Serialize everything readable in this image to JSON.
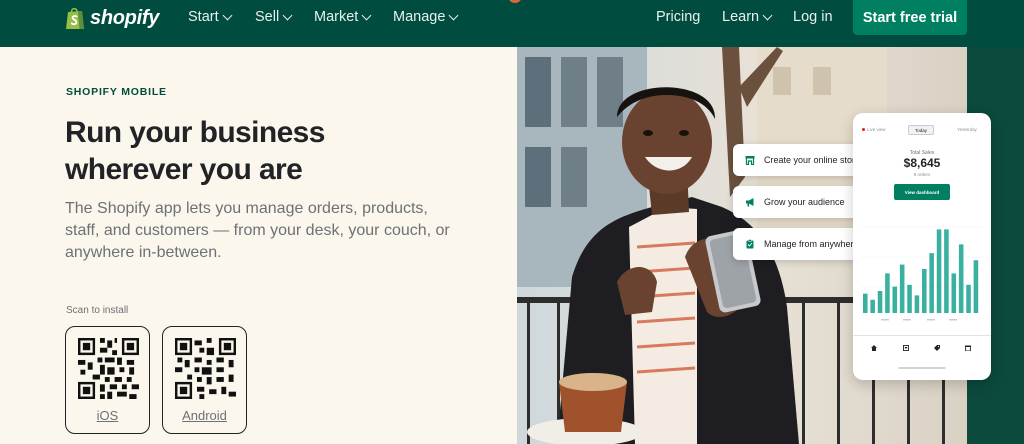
{
  "colors": {
    "nav_bg": "#004c3f",
    "brand_green": "#008060",
    "page_bg": "#fbf7ed",
    "text_dark": "#212326",
    "text_muted": "#6d7175",
    "chart_bar": "#3ab0a0"
  },
  "nav": {
    "logo_text": "shopify",
    "logo_icon": "shopping-bag-icon",
    "menus": [
      {
        "label": "Start"
      },
      {
        "label": "Sell"
      },
      {
        "label": "Market"
      },
      {
        "label": "Manage"
      }
    ],
    "pricing_label": "Pricing",
    "learn_label": "Learn",
    "login_label": "Log in",
    "cta_label": "Start free trial"
  },
  "hero": {
    "eyebrow": "SHOPIFY MOBILE",
    "headline": "Run your business wherever you are",
    "lede": "The Shopify app lets you manage orders, products, staff, and customers — from your desk, your couch, or anywhere in-between.",
    "scan_label": "Scan to install",
    "qr_codes": [
      {
        "label": "iOS"
      },
      {
        "label": "Android"
      }
    ]
  },
  "feature_pills": [
    {
      "label": "Create your online store",
      "icon": "storefront-icon"
    },
    {
      "label": "Grow your audience",
      "icon": "megaphone-icon"
    },
    {
      "label": "Manage from anywhere",
      "icon": "clipboard-icon"
    }
  ],
  "phone": {
    "live_label": "Live view",
    "today_label": "Today",
    "yesterday_label": "Yesterday",
    "total_label": "Total Sales",
    "total_value": "$8,645",
    "orders_label": "8 orders",
    "button_label": "View dashboard",
    "nav_icons": [
      "home-icon",
      "orders-icon",
      "tag-icon",
      "store-icon"
    ]
  },
  "chart_data": {
    "type": "bar",
    "values": [
      0.22,
      0.15,
      0.25,
      0.45,
      0.3,
      0.55,
      0.32,
      0.2,
      0.5,
      0.68,
      0.95,
      0.95,
      0.45,
      0.78,
      0.32,
      0.6
    ]
  }
}
